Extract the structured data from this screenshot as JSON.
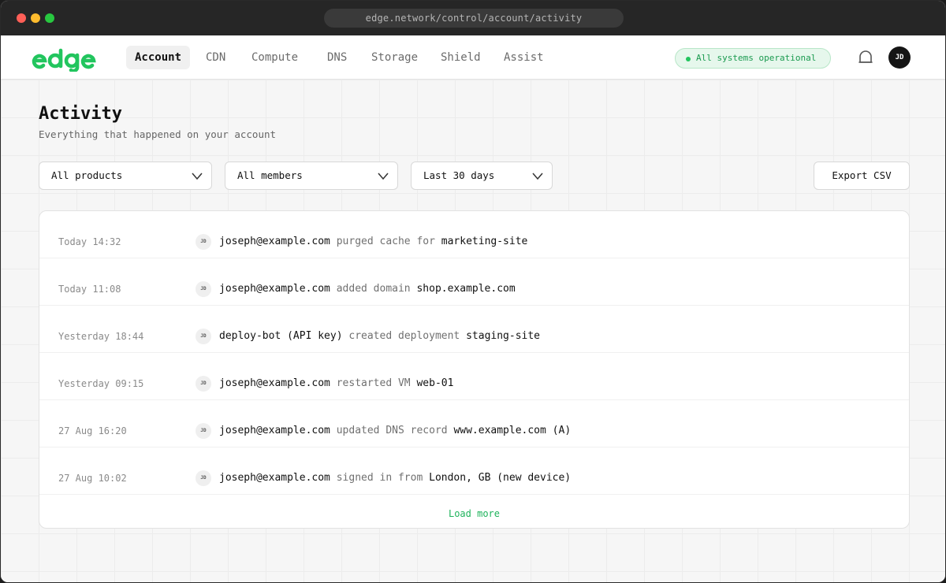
{
  "browser": {
    "url": "edge.network/control/account/activity"
  },
  "brand": {
    "name": "edge",
    "color": "#22c55e"
  },
  "nav": {
    "tabs": [
      {
        "label": "Account",
        "active": true
      },
      {
        "label": "CDN"
      },
      {
        "label": "Compute"
      },
      {
        "label": "DNS"
      },
      {
        "label": "Storage"
      },
      {
        "label": "Shield"
      },
      {
        "label": "Assist"
      }
    ],
    "status": "All systems operational",
    "avatar": "JD",
    "icons": {
      "notifications": "bell-icon"
    }
  },
  "page": {
    "title": "Activity",
    "subtitle": "Everything that happened on your account"
  },
  "filters": {
    "product": "All products",
    "member": "All members",
    "range": "Last 30 days",
    "export_label": "Export CSV"
  },
  "activity": [
    {
      "time": "Today 14:32",
      "avatar": "JD",
      "actor": "joseph@example.com",
      "action": "purged cache for",
      "target": "marketing-site"
    },
    {
      "time": "Today 11:08",
      "avatar": "JD",
      "actor": "joseph@example.com",
      "action": "added domain",
      "target": "shop.example.com"
    },
    {
      "time": "Yesterday 18:44",
      "avatar": "JD",
      "actor": "deploy-bot (API key)",
      "action": "created deployment",
      "target": "staging-site"
    },
    {
      "time": "Yesterday 09:15",
      "avatar": "JD",
      "actor": "joseph@example.com",
      "action": "restarted VM",
      "target": "web-01"
    },
    {
      "time": "27 Aug 16:20",
      "avatar": "JD",
      "actor": "joseph@example.com",
      "action": "updated DNS record",
      "target": "www.example.com (A)"
    },
    {
      "time": "27 Aug 10:02",
      "avatar": "JD",
      "actor": "joseph@example.com",
      "action": "signed in from",
      "target": "London, GB (new device)"
    }
  ],
  "load_more": "Load more",
  "colors": {
    "accent": "#22c55e",
    "status_bg": "#e6f7ec"
  }
}
